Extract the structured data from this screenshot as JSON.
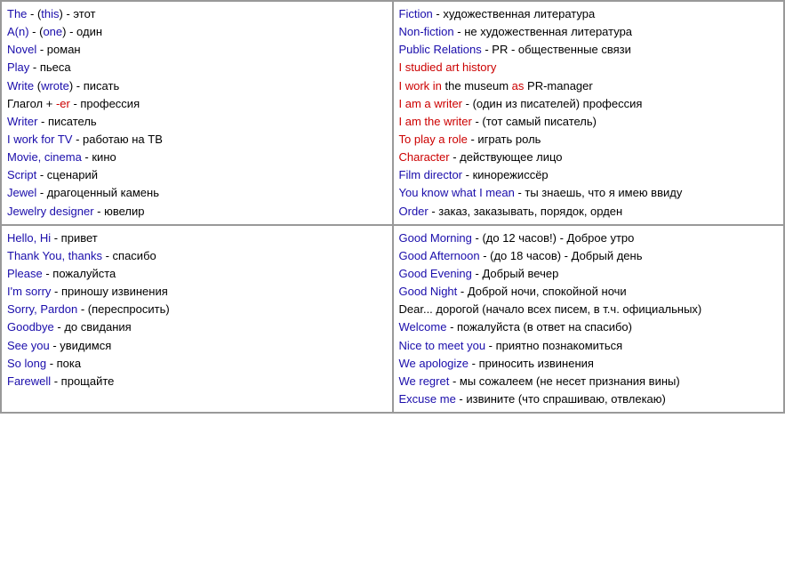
{
  "grid": {
    "topLeft": [
      {
        "html": "<span class='blue'>The</span> - (<span class='blue'>this</span>) - этот"
      },
      {
        "html": "<span class='blue'>A(n)</span> - (<span class='blue'>one</span>) - один"
      },
      {
        "html": "<span class='blue'>Novel</span> - роман"
      },
      {
        "html": "<span class='blue'>Play</span> - пьеса"
      },
      {
        "html": "<span class='blue'>Write</span> (<span class='blue'>wrote</span>) - писать"
      },
      {
        "html": "Глагол + <span class='red'>-er</span> - профессия"
      },
      {
        "html": "<span class='blue'>Writer</span> - писатель"
      },
      {
        "html": "<span class='blue'>I work for TV</span> - работаю на ТВ"
      },
      {
        "html": "<span class='blue'>Movie, cinema</span> - кино"
      },
      {
        "html": "<span class='blue'>Script</span> - сценарий"
      },
      {
        "html": "<span class='blue'>Jewel</span> - драгоценный камень"
      },
      {
        "html": "<span class='blue'>Jewelry designer</span> - ювелир"
      }
    ],
    "topRight": [
      {
        "html": "<span class='blue'>Fiction</span> - художественная литература"
      },
      {
        "html": "<span class='blue'>Non-fiction</span> - не художественная литература"
      },
      {
        "html": "<span class='blue'>Public Relations</span> - PR - общественные связи"
      },
      {
        "html": "<span class='red'>I studied art history</span>"
      },
      {
        "html": "<span class='red'>I work in</span> the museum <span class='red'>as</span> PR-manager"
      },
      {
        "html": "<span class='red'>I am a writer</span> - (один из писателей) профессия"
      },
      {
        "html": "<span class='red'>I am the writer</span> - (тот самый писатель)"
      },
      {
        "html": "<span class='red'>To play a role</span> - играть роль"
      },
      {
        "html": "<span class='red'>Character</span> - действующее лицо"
      },
      {
        "html": "<span class='blue'>Film director</span> - кинорежиссёр"
      },
      {
        "html": "<span class='blue'>You know what I mean</span> - ты знаешь, что я имею ввиду"
      },
      {
        "html": "<span class='blue'>Order</span> - заказ, заказывать, порядок, орден"
      }
    ],
    "bottomLeft": [
      {
        "html": "<span class='blue'>Hello, Hi</span> - привет"
      },
      {
        "html": "<span class='blue'>Thank You, thanks</span> - спасибо"
      },
      {
        "html": "<span class='blue'>Please</span> - пожалуйста"
      },
      {
        "html": "<span class='blue'>I'm sorry</span> - приношу извинения"
      },
      {
        "html": "<span class='blue'>Sorry, Pardon</span> - (переспросить)"
      },
      {
        "html": "<span class='blue'>Goodbye</span> - до свидания"
      },
      {
        "html": "<span class='blue'>See you</span> - увидимся"
      },
      {
        "html": "<span class='blue'>So long</span> - пока"
      },
      {
        "html": "<span class='blue'>Farewell</span> - прощайте"
      }
    ],
    "bottomRight": [
      {
        "html": "<span class='blue'>Good Morning</span> - (до 12 часов!) - Доброе утро"
      },
      {
        "html": "<span class='blue'>Good Afternoon</span> - (до 18 часов) - Добрый день"
      },
      {
        "html": "<span class='blue'>Good Evening</span> - Добрый вечер"
      },
      {
        "html": "<span class='blue'>Good Night</span> - Доброй ночи, спокойной ночи"
      },
      {
        "html": "Dear... дорогой (начало всех писем, в т.ч. официальных)"
      },
      {
        "html": "<span class='blue'>Welcome</span> - пожалуйста (в ответ на спасибо)"
      },
      {
        "html": "<span class='blue'>Nice to meet you</span> - приятно познакомиться"
      },
      {
        "html": "<span class='blue'>We apologize</span> - приносить извинения"
      },
      {
        "html": "<span class='blue'>We regret</span> - мы сожалеем (не несет признания вины)"
      },
      {
        "html": "<span class='blue'>Excuse me</span> - извините (что спрашиваю, отвлекаю)"
      }
    ]
  }
}
